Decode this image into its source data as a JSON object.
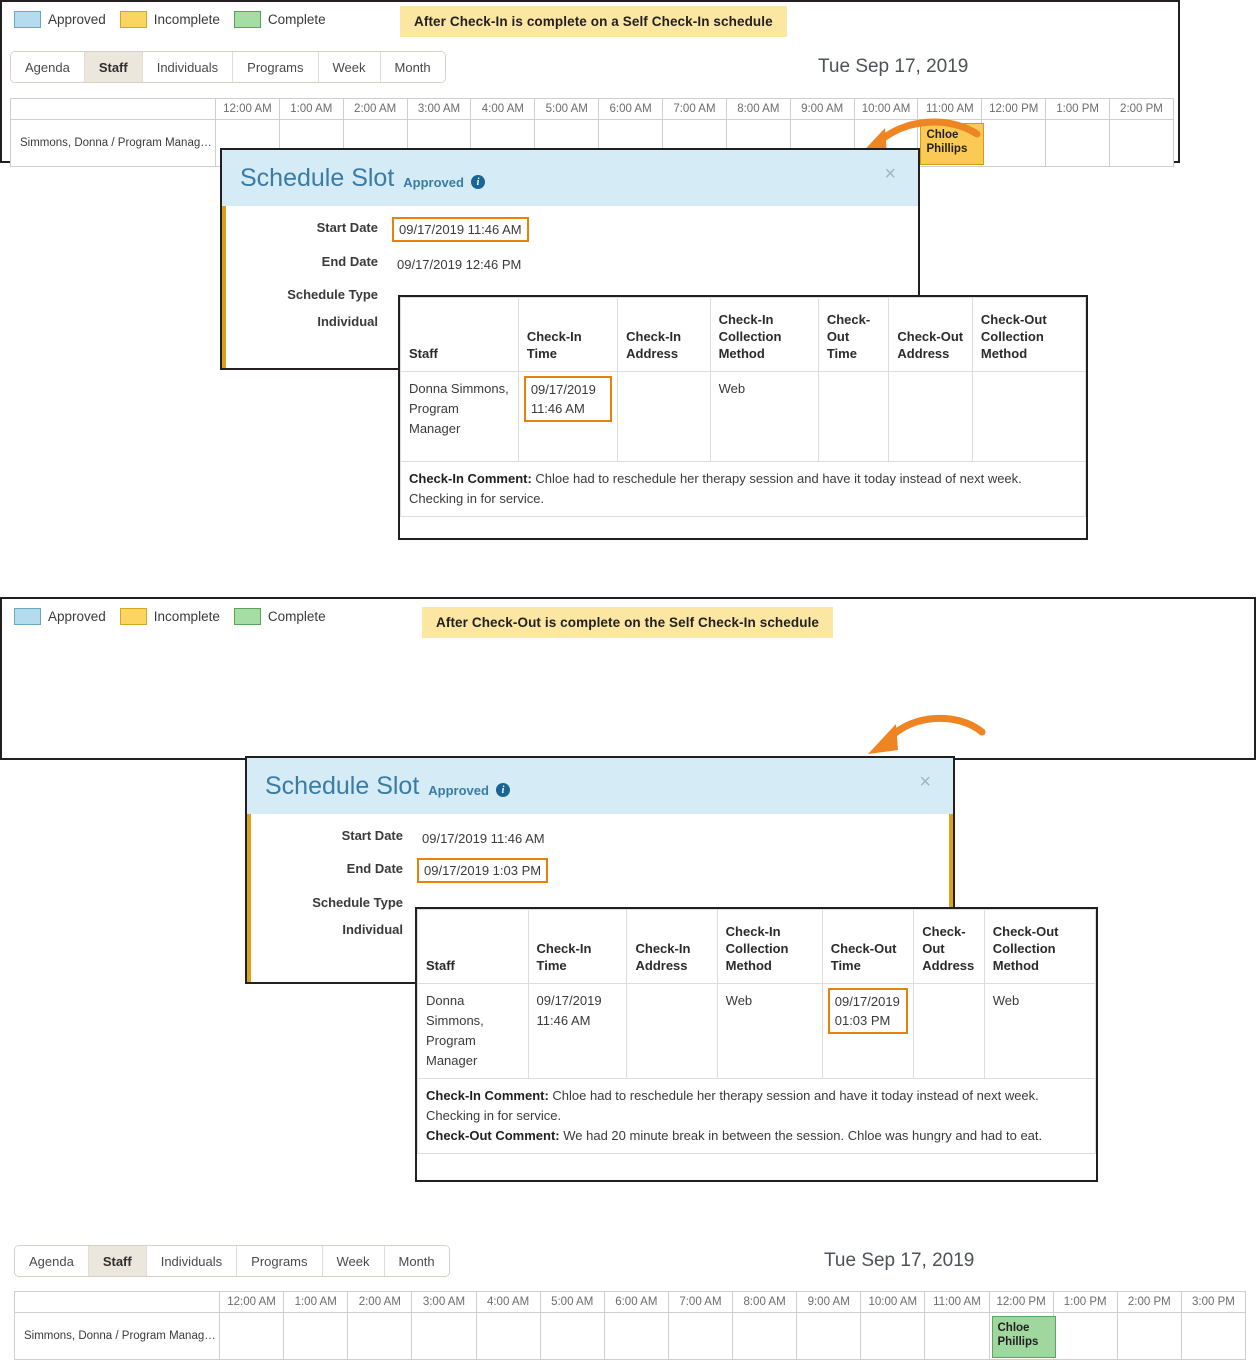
{
  "legend": {
    "items": [
      {
        "label": "Approved",
        "color": "#b3dcee"
      },
      {
        "label": "Incomplete",
        "color": "#fcd462"
      },
      {
        "label": "Complete",
        "color": "#a5dda5"
      }
    ]
  },
  "tabs": [
    {
      "label": "Agenda",
      "active": false
    },
    {
      "label": "Staff",
      "active": true
    },
    {
      "label": "Individuals",
      "active": false
    },
    {
      "label": "Programs",
      "active": false
    },
    {
      "label": "Week",
      "active": false
    },
    {
      "label": "Month",
      "active": false
    }
  ],
  "panel_top": {
    "callout": "After Check-In is complete on a Self Check-In schedule",
    "date_title": "Tue Sep 17, 2019",
    "grid": {
      "name_header": "",
      "hours": [
        "12:00 AM",
        "1:00 AM",
        "2:00 AM",
        "3:00 AM",
        "4:00 AM",
        "5:00 AM",
        "6:00 AM",
        "7:00 AM",
        "8:00 AM",
        "9:00 AM",
        "10:00 AM",
        "11:00 AM",
        "12:00 PM",
        "1:00 PM",
        "2:00 PM"
      ],
      "staff_row_label": "Simmons, Donna / Program Manag…",
      "event": {
        "label": "Chloe\nPhillips",
        "name_line1": "Chloe",
        "name_line2": "Phillips",
        "status": "Incomplete",
        "hour_index": 11
      }
    },
    "modal": {
      "title": "Schedule Slot",
      "status": "Approved",
      "info_icon": "info-icon",
      "close_icon": "close-icon",
      "fields": [
        {
          "label": "Start Date",
          "value": "09/17/2019 11:46 AM",
          "highlighted": true
        },
        {
          "label": "End Date",
          "value": "09/17/2019 12:46 PM",
          "highlighted": false
        },
        {
          "label": "Schedule Type",
          "value": "",
          "highlighted": false
        },
        {
          "label": "Individual",
          "value": "",
          "highlighted": false
        }
      ]
    },
    "detail_table": {
      "headers": [
        "Staff",
        "Check-In Time",
        "Check-In Address",
        "Check-In Collection Method",
        "Check-Out Time",
        "Check-Out Address",
        "Check-Out Collection Method"
      ],
      "row": {
        "staff": "Donna Simmons, Program Manager",
        "check_in_time": "09/17/2019 11:46 AM",
        "check_in_time_highlighted": true,
        "check_in_address": "",
        "check_in_collection_method": "Web",
        "check_out_time": "",
        "check_out_time_highlighted": false,
        "check_out_address": "",
        "check_out_collection_method": ""
      },
      "comments": [
        {
          "label": "Check-In Comment:",
          "text": " Chloe had to reschedule her therapy session and have it today instead of next week. Checking in for service."
        }
      ]
    }
  },
  "panel_bottom": {
    "callout": "After Check-Out is complete on the Self Check-In schedule",
    "date_title": "Tue Sep 17, 2019",
    "grid": {
      "name_header": "",
      "hours": [
        "12:00 AM",
        "1:00 AM",
        "2:00 AM",
        "3:00 AM",
        "4:00 AM",
        "5:00 AM",
        "6:00 AM",
        "7:00 AM",
        "8:00 AM",
        "9:00 AM",
        "10:00 AM",
        "11:00 AM",
        "12:00 PM",
        "1:00 PM",
        "2:00 PM",
        "3:00 PM"
      ],
      "staff_row_label": "Simmons, Donna / Program Manag…",
      "event": {
        "label": "Chloe\nPhillips",
        "name_line1": "Chloe",
        "name_line2": "Phillips",
        "status": "Complete",
        "hour_index": 12
      }
    },
    "modal": {
      "title": "Schedule Slot",
      "status": "Approved",
      "info_icon": "info-icon",
      "close_icon": "close-icon",
      "fields": [
        {
          "label": "Start Date",
          "value": "09/17/2019 11:46 AM",
          "highlighted": false
        },
        {
          "label": "End Date",
          "value": "09/17/2019 1:03 PM",
          "highlighted": true
        },
        {
          "label": "Schedule Type",
          "value": "",
          "highlighted": false
        },
        {
          "label": "Individual",
          "value": "",
          "highlighted": false
        }
      ]
    },
    "detail_table": {
      "headers": [
        "Staff",
        "Check-In Time",
        "Check-In Address",
        "Check-In Collection Method",
        "Check-Out Time",
        "Check-Out Address",
        "Check-Out Collection Method"
      ],
      "row": {
        "staff": "Donna Simmons, Program Manager",
        "check_in_time": "09/17/2019 11:46 AM",
        "check_in_time_highlighted": false,
        "check_in_address": "",
        "check_in_collection_method": "Web",
        "check_out_time": "09/17/2019 01:03 PM",
        "check_out_time_highlighted": true,
        "check_out_address": "",
        "check_out_collection_method": "Web"
      },
      "comments": [
        {
          "label": "Check-In Comment:",
          "text": " Chloe had to reschedule her therapy session and have it today instead of next week. Checking in for service."
        },
        {
          "label": "Check-Out Comment:",
          "text": " We had 20 minute break in between the session. Chloe was hungry and had to eat."
        }
      ]
    }
  },
  "colors": {
    "approved": "#b3dcee",
    "incomplete": "#fcd462",
    "complete": "#a5dda5",
    "highlight_border": "#e8820c",
    "arrow": "#ef8422",
    "callout_bg": "#fbe7a2",
    "modal_header_bg": "#d5ebf5",
    "modal_title": "#3a7ca5",
    "modal_stripe": "#d9a21b"
  }
}
